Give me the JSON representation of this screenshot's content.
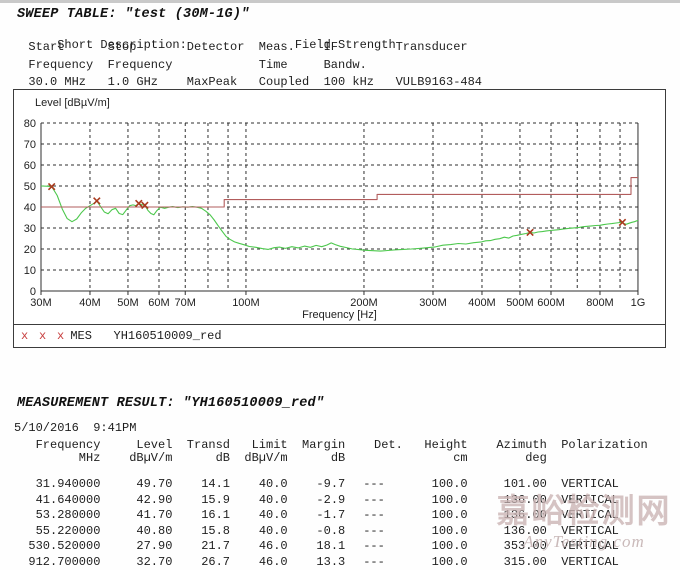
{
  "sweep_table": {
    "title": "SWEEP TABLE: \"test (30M-1G)\"",
    "short_description_label": "Short Description:",
    "short_description_value": "Field Strength",
    "columns": [
      {
        "line1": "Start",
        "line2": "Frequency",
        "value": "30.0 MHz"
      },
      {
        "line1": "Stop",
        "line2": "Frequency",
        "value": "1.0 GHz"
      },
      {
        "line1": "Detector",
        "line2": "",
        "value": "MaxPeak"
      },
      {
        "line1": "Meas.",
        "line2": "Time",
        "value": "Coupled"
      },
      {
        "line1": "IF",
        "line2": "Bandw.",
        "value": "100 kHz"
      },
      {
        "line1": "Transducer",
        "line2": "",
        "value": "VULB9163-484"
      }
    ]
  },
  "legend": {
    "marker": "x x x",
    "label": "MES",
    "trace_name": "YH160510009_red"
  },
  "measurement_result": {
    "title": "MEASUREMENT RESULT: \"YH160510009_red\"",
    "timestamp": "5/10/2016  9:41PM",
    "columns": [
      {
        "label": "Frequency",
        "unit": "MHz"
      },
      {
        "label": "Level",
        "unit": "dBµV/m"
      },
      {
        "label": "Transd",
        "unit": "dB"
      },
      {
        "label": "Limit",
        "unit": "dBµV/m"
      },
      {
        "label": "Margin",
        "unit": "dB"
      },
      {
        "label": "Det.",
        "unit": ""
      },
      {
        "label": "Height",
        "unit": "cm"
      },
      {
        "label": "Azimuth",
        "unit": "deg"
      },
      {
        "label": "Polarization",
        "unit": ""
      }
    ],
    "rows": [
      [
        "31.940000",
        "49.70",
        "14.1",
        "40.0",
        "-9.7",
        "---",
        "100.0",
        "101.00",
        "VERTICAL"
      ],
      [
        "41.640000",
        "42.90",
        "15.9",
        "40.0",
        "-2.9",
        "---",
        "100.0",
        "136.00",
        "VERTICAL"
      ],
      [
        "53.280000",
        "41.70",
        "16.1",
        "40.0",
        "-1.7",
        "---",
        "100.0",
        "136.00",
        "VERTICAL"
      ],
      [
        "55.220000",
        "40.80",
        "15.8",
        "40.0",
        "-0.8",
        "---",
        "100.0",
        "136.00",
        "VERTICAL"
      ],
      [
        "530.520000",
        "27.90",
        "21.7",
        "46.0",
        "18.1",
        "---",
        "100.0",
        "353.00",
        "VERTICAL"
      ],
      [
        "912.700000",
        "32.70",
        "26.7",
        "46.0",
        "13.3",
        "---",
        "100.0",
        "315.00",
        "VERTICAL"
      ]
    ]
  },
  "watermark": {
    "cn": "嘉峪检测网",
    "en": "AnyTesting.com"
  },
  "chart_data": {
    "type": "line",
    "title": "Level [dBµV/m]",
    "xlabel": "Frequency [Hz]",
    "x_scale": "log",
    "x_range_mhz": [
      30,
      1000
    ],
    "ylim": [
      0,
      80
    ],
    "grid": true,
    "y_ticks": [
      0,
      10,
      20,
      30,
      40,
      50,
      60,
      70,
      80
    ],
    "x_gridlines_mhz": [
      40,
      50,
      60,
      70,
      80,
      90,
      100,
      200,
      300,
      400,
      500,
      600,
      700,
      800,
      900
    ],
    "x_tick_labels": [
      {
        "mhz": 30,
        "label": "30M"
      },
      {
        "mhz": 40,
        "label": "40M"
      },
      {
        "mhz": 50,
        "label": "50M"
      },
      {
        "mhz": 60,
        "label": "60M"
      },
      {
        "mhz": 70,
        "label": "70M"
      },
      {
        "mhz": 100,
        "label": "100M"
      },
      {
        "mhz": 200,
        "label": "200M"
      },
      {
        "mhz": 300,
        "label": "300M"
      },
      {
        "mhz": 400,
        "label": "400M"
      },
      {
        "mhz": 500,
        "label": "500M"
      },
      {
        "mhz": 600,
        "label": "600M"
      },
      {
        "mhz": 800,
        "label": "800M"
      },
      {
        "mhz": 1000,
        "label": "1G"
      }
    ],
    "series": [
      {
        "name": "MES YH160510009_red",
        "color": "#4dc84d",
        "points": [
          [
            30,
            50
          ],
          [
            31,
            49.9
          ],
          [
            31.94,
            49.7
          ],
          [
            33,
            45.5
          ],
          [
            34,
            39
          ],
          [
            35,
            34.5
          ],
          [
            36,
            33
          ],
          [
            37,
            34.3
          ],
          [
            38,
            37.2
          ],
          [
            39,
            39.4
          ],
          [
            40,
            40.6
          ],
          [
            41,
            41.8
          ],
          [
            41.64,
            42.9
          ],
          [
            42.5,
            40.4
          ],
          [
            43.5,
            37.6
          ],
          [
            44.5,
            36.8
          ],
          [
            45.5,
            38.7
          ],
          [
            46.5,
            39.4
          ],
          [
            47.5,
            36.9
          ],
          [
            48.5,
            36.4
          ],
          [
            49.5,
            38.6
          ],
          [
            50.5,
            40.6
          ],
          [
            51.5,
            41
          ],
          [
            52.4,
            40.6
          ],
          [
            53.28,
            41.7
          ],
          [
            54.2,
            41.1
          ],
          [
            55.22,
            40.8
          ],
          [
            56.2,
            38.4
          ],
          [
            57.2,
            36.9
          ],
          [
            58.2,
            36.3
          ],
          [
            59.2,
            38.2
          ],
          [
            60.5,
            39.9
          ],
          [
            62,
            39.4
          ],
          [
            63.5,
            39.9
          ],
          [
            65,
            40.2
          ],
          [
            67,
            39.7
          ],
          [
            69,
            40.1
          ],
          [
            71,
            39.9
          ],
          [
            73,
            40.2
          ],
          [
            75,
            39.9
          ],
          [
            77,
            39.4
          ],
          [
            79,
            38
          ],
          [
            81,
            36.3
          ],
          [
            83,
            33.8
          ],
          [
            85,
            31
          ],
          [
            87,
            28.4
          ],
          [
            89,
            26
          ],
          [
            91,
            24.6
          ],
          [
            93.5,
            23.4
          ],
          [
            96,
            22.7
          ],
          [
            99,
            22
          ],
          [
            102,
            21.2
          ],
          [
            106,
            20.8
          ],
          [
            110,
            20.2
          ],
          [
            114,
            19.8
          ],
          [
            118,
            20.6
          ],
          [
            122,
            20.9
          ],
          [
            126,
            20.3
          ],
          [
            131,
            21.1
          ],
          [
            136,
            20.5
          ],
          [
            141,
            21.4
          ],
          [
            146,
            20.8
          ],
          [
            151,
            21.7
          ],
          [
            156,
            21.1
          ],
          [
            161,
            21.9
          ],
          [
            165,
            22.9
          ],
          [
            169,
            22.1
          ],
          [
            174,
            21.3
          ],
          [
            180,
            20.7
          ],
          [
            187,
            20
          ],
          [
            194,
            19.7
          ],
          [
            202,
            19.4
          ],
          [
            211,
            19.2
          ],
          [
            220,
            19
          ],
          [
            230,
            19.3
          ],
          [
            241,
            19.6
          ],
          [
            252,
            19.8
          ],
          [
            264,
            20
          ],
          [
            277,
            20.3
          ],
          [
            290,
            20.6
          ],
          [
            304,
            21
          ],
          [
            318,
            21.8
          ],
          [
            333,
            22.1
          ],
          [
            348,
            22.6
          ],
          [
            364,
            22.4
          ],
          [
            381,
            23
          ],
          [
            399,
            23.4
          ],
          [
            409,
            23.9
          ],
          [
            420,
            24
          ],
          [
            432,
            24.6
          ],
          [
            444,
            24.9
          ],
          [
            456,
            25.6
          ],
          [
            468,
            25.2
          ],
          [
            480,
            26.2
          ],
          [
            492,
            26.5
          ],
          [
            505,
            27
          ],
          [
            518,
            27.4
          ],
          [
            530.52,
            27.9
          ],
          [
            543,
            27.6
          ],
          [
            556,
            28.1
          ],
          [
            570,
            28.3
          ],
          [
            584,
            28.6
          ],
          [
            598,
            28.8
          ],
          [
            613,
            29
          ],
          [
            628,
            29.2
          ],
          [
            643,
            29.5
          ],
          [
            659,
            29.7
          ],
          [
            675,
            29.9
          ],
          [
            691,
            30.1
          ],
          [
            708,
            30.3
          ],
          [
            725,
            30.6
          ],
          [
            743,
            30.8
          ],
          [
            761,
            31
          ],
          [
            780,
            31.2
          ],
          [
            799,
            31.3
          ],
          [
            818,
            31.6
          ],
          [
            838,
            31.9
          ],
          [
            858,
            32.1
          ],
          [
            879,
            32.4
          ],
          [
            900,
            32.6
          ],
          [
            912.7,
            32.7
          ],
          [
            921,
            32
          ],
          [
            935,
            31.8
          ],
          [
            950,
            32.3
          ],
          [
            965,
            32.7
          ],
          [
            980,
            33
          ],
          [
            1000,
            33.6
          ]
        ]
      },
      {
        "name": "Limit",
        "color": "#b25c5c",
        "points": [
          [
            30,
            40
          ],
          [
            88,
            40
          ],
          [
            88,
            43.5
          ],
          [
            216,
            43.5
          ],
          [
            216,
            46
          ],
          [
            960,
            46
          ],
          [
            960,
            54
          ],
          [
            1000,
            54
          ]
        ]
      }
    ],
    "markers": {
      "color": "#a93b1e",
      "points": [
        [
          31.94,
          49.7
        ],
        [
          41.64,
          42.9
        ],
        [
          53.28,
          41.7
        ],
        [
          55.22,
          40.8
        ],
        [
          530.52,
          27.9
        ],
        [
          912.7,
          32.7
        ]
      ]
    }
  }
}
